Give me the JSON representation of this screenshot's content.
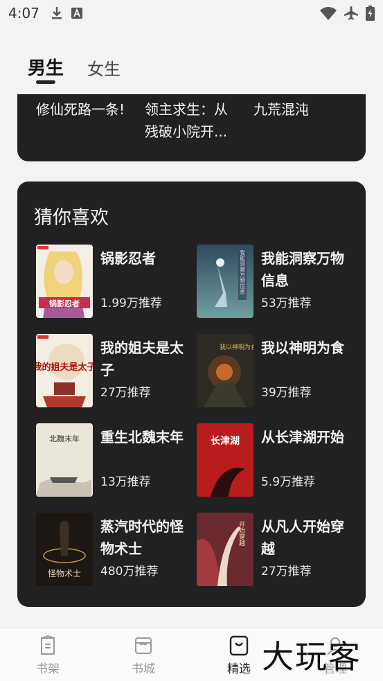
{
  "status_bar": {
    "time": "4:07",
    "left_icons": [
      "download-icon",
      "font-a-icon"
    ],
    "right_icons": [
      "wifi-icon",
      "airplane-icon",
      "battery-charging-icon"
    ]
  },
  "gender_tabs": [
    {
      "label": "男生",
      "active": true
    },
    {
      "label": "女生",
      "active": false
    }
  ],
  "top_books": [
    {
      "title": "修仙死路一条!"
    },
    {
      "title": "领主求生：从残破小院开..."
    },
    {
      "title": "九荒混沌"
    }
  ],
  "guess_section": {
    "title": "猜你喜欢",
    "books": [
      {
        "title": "锅影忍者",
        "recs": "1.99万推荐",
        "cover_text": "锅影忍者"
      },
      {
        "title": "我能洞察万物信息",
        "recs": "53万推荐",
        "cover_text": "我能洞察万物信息"
      },
      {
        "title": "我的姐夫是太子",
        "recs": "27万推荐",
        "cover_text": "我的姐夫是太子"
      },
      {
        "title": "我以神明为食",
        "recs": "39万推荐",
        "cover_text": "我以神明为食"
      },
      {
        "title": "重生北魏末年",
        "recs": "13万推荐",
        "cover_text": "北魏末年"
      },
      {
        "title": "从长津湖开始",
        "recs": "5.9万推荐",
        "cover_text": "长津湖"
      },
      {
        "title": "蒸汽时代的怪物术士",
        "recs": "480万推荐",
        "cover_text": "怪物术士"
      },
      {
        "title": "从凡人开始穿越",
        "recs": "27万推荐",
        "cover_text": "开始穿越"
      }
    ]
  },
  "bottom_nav": [
    {
      "label": "书架",
      "icon": "bookshelf-icon",
      "active": false
    },
    {
      "label": "书城",
      "icon": "bookstore-icon",
      "active": false
    },
    {
      "label": "精选",
      "icon": "featured-bag-icon",
      "active": true
    },
    {
      "label": "管理",
      "icon": "profile-icon",
      "active": false
    }
  ],
  "watermark": "大玩客",
  "colors": {
    "background": "#f3f3f3",
    "card": "#212121",
    "text_on_card": "#f2f2f2",
    "nav_inactive": "#9a9a9a",
    "nav_active": "#222222"
  }
}
